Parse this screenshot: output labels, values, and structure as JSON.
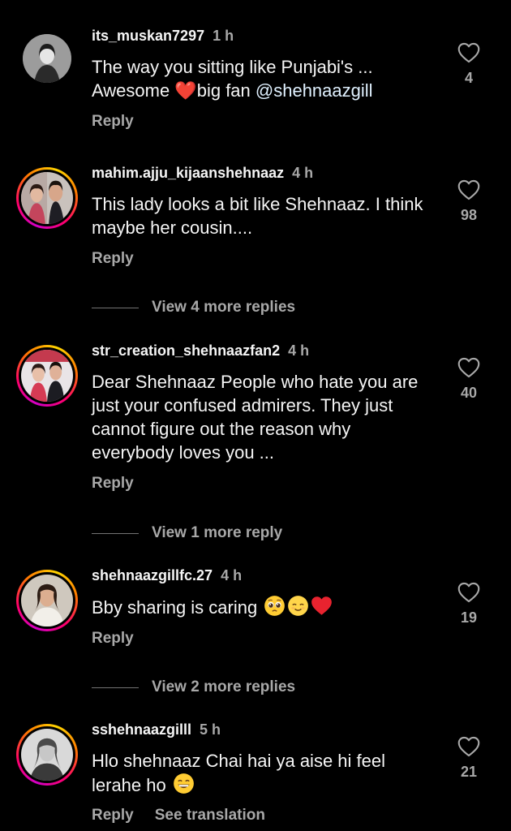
{
  "colors": {
    "background": "#000000",
    "primary_text": "#f5f5f5",
    "secondary_text": "#a8a8a8",
    "heart": "#ed4956",
    "mention": "#e0f1ff",
    "story_ring": [
      "#d300c5",
      "#ff0069",
      "#ff7a00",
      "#ffd600"
    ]
  },
  "comments": [
    {
      "username": "its_muskan7297",
      "time": "1 h",
      "text_before": "The way you sitting like Punjabi's ... Awesome ",
      "heart_emoji": "❤️",
      "text_middle": "big fan ",
      "mention": "@shehnaazgill",
      "likes": "4",
      "reply_label": "Reply",
      "avatar_icon": "avatar-grayscale-photo",
      "story_ring": false
    },
    {
      "username": "mahim.ajju_kijaanshehnaaz",
      "time": "4 h",
      "text": "This lady looks a bit like Shehnaaz. I think maybe her cousin....",
      "likes": "98",
      "reply_label": "Reply",
      "view_more": "View 4 more replies",
      "story_ring": true
    },
    {
      "username": "str_creation_shehnaazfan2",
      "time": "4 h",
      "text": "Dear Shehnaaz People who hate you are just your confused admirers. They just cannot figure out the reason why everybody loves you ...",
      "likes": "40",
      "reply_label": "Reply",
      "view_more": "View 1 more reply",
      "story_ring": true
    },
    {
      "username": "shehnaazgillfc.27",
      "time": "4 h",
      "text": "Bby sharing is caring ",
      "emojis": [
        "pleading-face-emoji",
        "relieved-face-emoji",
        "red-heart-emoji"
      ],
      "likes": "19",
      "reply_label": "Reply",
      "view_more": "View 2 more replies",
      "story_ring": true
    },
    {
      "username": "sshehnaazgilll",
      "time": "5 h",
      "text": "Hlo shehnaaz Chai hai ya aise hi feel lerahe ho ",
      "emojis": [
        "grinning-face-emoji"
      ],
      "likes": "21",
      "reply_label": "Reply",
      "see_translation": "See translation",
      "story_ring": true
    }
  ]
}
